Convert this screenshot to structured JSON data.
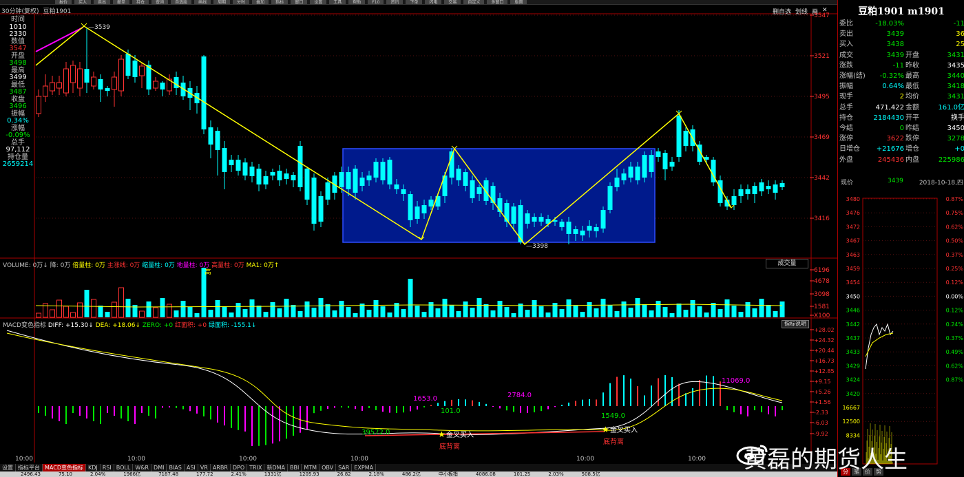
{
  "toolbar": {
    "buttons": [
      "报价",
      "买入",
      "卖出",
      "撤单",
      "持仓",
      "查询",
      "自选股",
      "画线",
      "周期",
      "分时",
      "叠加",
      "指标",
      "窗口",
      "设置",
      "工具",
      "帮助",
      "F10",
      "资讯",
      "下单",
      "闪电",
      "交易",
      "自定义",
      "多窗口",
      "版面"
    ]
  },
  "chart": {
    "period_label": "30分钟(复权)",
    "symbol": "豆粕1901",
    "right_tools": [
      "删自选",
      "划线",
      "画",
      "✕"
    ],
    "y_ticks": [
      "3547",
      "3521",
      "3495",
      "3469",
      "3442",
      "3416"
    ],
    "high_marker": "3539",
    "low_marker": "3398",
    "time_labels": [
      "10:00",
      "10:00",
      "10:00",
      "10:00",
      "10:00",
      "10:00"
    ]
  },
  "left_info": [
    {
      "label": "时间",
      "value": "1010",
      "value2": "2330",
      "color": "white"
    },
    {
      "label": "数值",
      "value": "3547",
      "color": "red"
    },
    {
      "label": "开盘",
      "value": "3498",
      "color": "green"
    },
    {
      "label": "最高",
      "value": "3499",
      "color": "white"
    },
    {
      "label": "最低",
      "value": "3487",
      "color": "green"
    },
    {
      "label": "收盘",
      "value": "3496",
      "color": "green"
    },
    {
      "label": "振幅",
      "value": "0.34%",
      "color": "cyan"
    },
    {
      "label": "涨幅",
      "value": "-0.09%",
      "color": "green"
    },
    {
      "label": "总手",
      "value": "97,112",
      "color": "white"
    },
    {
      "label": "持仓量",
      "value": "2659214",
      "color": "cyan"
    }
  ],
  "volume_pane": {
    "header": [
      {
        "text": "VOLUME: 0万↓",
        "color": "#c0c0c0"
      },
      {
        "text": "降: 0万",
        "color": "#c0c0c0"
      },
      {
        "text": "倍量柱: 0万",
        "color": "#ffff00"
      },
      {
        "text": "主涨线: 0万",
        "color": "#ff3232"
      },
      {
        "text": "缩量柱: 0万",
        "color": "#00ffff"
      },
      {
        "text": "地量柱: 0万",
        "color": "#ff00ff"
      },
      {
        "text": "高量柱: 0万",
        "color": "#ff3232"
      },
      {
        "text": "MA1: 0万↑",
        "color": "#ffff00"
      }
    ],
    "selector": "成交量",
    "y_ticks": [
      "6196",
      "4678",
      "3098",
      "1581",
      "X100"
    ],
    "peak_label": "高"
  },
  "macd_pane": {
    "header": [
      {
        "text": "MACD变色指标",
        "color": "#c0c0c0"
      },
      {
        "text": "DIFF: +15.30↓",
        "color": "#ffffff"
      },
      {
        "text": "DEA: +18.06↓",
        "color": "#ffff00"
      },
      {
        "text": "ZERO: +0",
        "color": "#00e600"
      },
      {
        "text": "红面积: +0",
        "color": "#ff3232"
      },
      {
        "text": "绿面积: -155.1↓",
        "color": "#00ffff"
      }
    ],
    "button": "指标说明",
    "y_ticks": [
      "+28.02",
      "+24.32",
      "+20.44",
      "+16.73",
      "+12.85",
      "+9.15",
      "+5.26",
      "+1.56",
      "-2.33",
      "-6.03",
      "-9.92"
    ],
    "labels": [
      {
        "text": "39572.0",
        "color": "#00e600"
      },
      {
        "text": "101.0",
        "color": "#00e600"
      },
      {
        "text": "1653.0",
        "color": "#ff00ff"
      },
      {
        "text": "2784.0",
        "color": "#ff00ff"
      },
      {
        "text": "1549.0",
        "color": "#00e600"
      },
      {
        "text": "11069.0",
        "color": "#ff00ff"
      }
    ],
    "signals": [
      {
        "star": "★",
        "text": "金叉买入",
        "note": "底背离"
      },
      {
        "star": "★",
        "text": "金叉买入",
        "note": "底背离"
      }
    ]
  },
  "bottom_tabs": [
    "设置",
    "指标平台",
    "MACD变色指标",
    "KDJ",
    "RSI",
    "BOLL",
    "W&R",
    "DMI",
    "BIAS",
    "ASI",
    "VR",
    "ARBR",
    "DPO",
    "TRIX",
    "新DMA",
    "BBI",
    "MTM",
    "OBV",
    "SAR",
    "EXPMA"
  ],
  "status_bar": [
    "2496.43",
    "75.10",
    "2.04%",
    "1966亿",
    "7187.48",
    "177.72",
    "2.41%",
    "1331亿",
    "1205.93",
    "26.82",
    "2.18%",
    "486.2亿",
    "中小板指",
    "4086.08",
    "101.25",
    "2.03%",
    "508.5亿"
  ],
  "quote": {
    "title": "豆粕1901 m1901",
    "rows": [
      {
        "l1": "委比",
        "v1": "-18.03%",
        "c1": "green",
        "l2": "",
        "v2": "-11",
        "c2": "green"
      },
      {
        "l1": "卖出",
        "v1": "3439",
        "c1": "green",
        "l2": "",
        "v2": "36",
        "c2": "yellow"
      },
      {
        "l1": "买入",
        "v1": "3438",
        "c1": "green",
        "l2": "",
        "v2": "25",
        "c2": "yellow"
      },
      {
        "l1": "成交",
        "v1": "3439",
        "c1": "green",
        "l2": "开盘",
        "v2": "3431",
        "c2": "green"
      },
      {
        "l1": "涨跌",
        "v1": "-11",
        "c1": "green",
        "l2": "昨收",
        "v2": "3435",
        "c2": "white"
      },
      {
        "l1": "涨幅(结)",
        "v1": "-0.32%",
        "c1": "green",
        "l2": "最高",
        "v2": "3440",
        "c2": "green"
      },
      {
        "l1": "振幅",
        "v1": "0.64%",
        "c1": "cyan",
        "l2": "最低",
        "v2": "3418",
        "c2": "green"
      },
      {
        "l1": "现手",
        "v1": "2",
        "c1": "yellow",
        "l2": "均价",
        "v2": "3431",
        "c2": "green"
      },
      {
        "l1": "总手",
        "v1": "471,422",
        "c1": "white",
        "l2": "金额",
        "v2": "161.0亿",
        "c2": "cyan"
      },
      {
        "l1": "持仓",
        "v1": "2184430",
        "c1": "cyan",
        "l2": "开平",
        "v2": "换手",
        "c2": "white"
      },
      {
        "l1": "今结",
        "v1": "0",
        "c1": "green",
        "l2": "昨结",
        "v2": "3450",
        "c2": "white"
      },
      {
        "l1": "涨停",
        "v1": "3622",
        "c1": "red",
        "l2": "跌停",
        "v2": "3278",
        "c2": "green"
      },
      {
        "l1": "日增仓",
        "v1": "+21676",
        "c1": "cyan",
        "l2": "增仓",
        "v2": "+0",
        "c2": "cyan"
      },
      {
        "l1": "外盘",
        "v1": "245436",
        "c1": "red",
        "l2": "内盘",
        "v2": "225986",
        "c2": "green"
      }
    ],
    "price_label": "现价",
    "price_value": "3439",
    "date": "2018-10-18,四",
    "mini_left_ticks": [
      "3480",
      "3476",
      "3472",
      "3467",
      "3463",
      "3459",
      "3454",
      "3450",
      "3446",
      "3442",
      "3437",
      "3433",
      "3429",
      "3424",
      "3420",
      "16667",
      "12500",
      "8334"
    ],
    "mini_right_ticks": [
      "0.87%",
      "0.75%",
      "0.62%",
      "0.50%",
      "0.37%",
      "0.25%",
      "0.12%",
      "0.00%",
      "0.12%",
      "0.24%",
      "0.37%",
      "0.49%",
      "0.62%",
      "0.87%"
    ],
    "bottom_tabs": [
      "分",
      "笔",
      "价",
      "势"
    ]
  },
  "watermark": "黄磊的期货人生"
}
